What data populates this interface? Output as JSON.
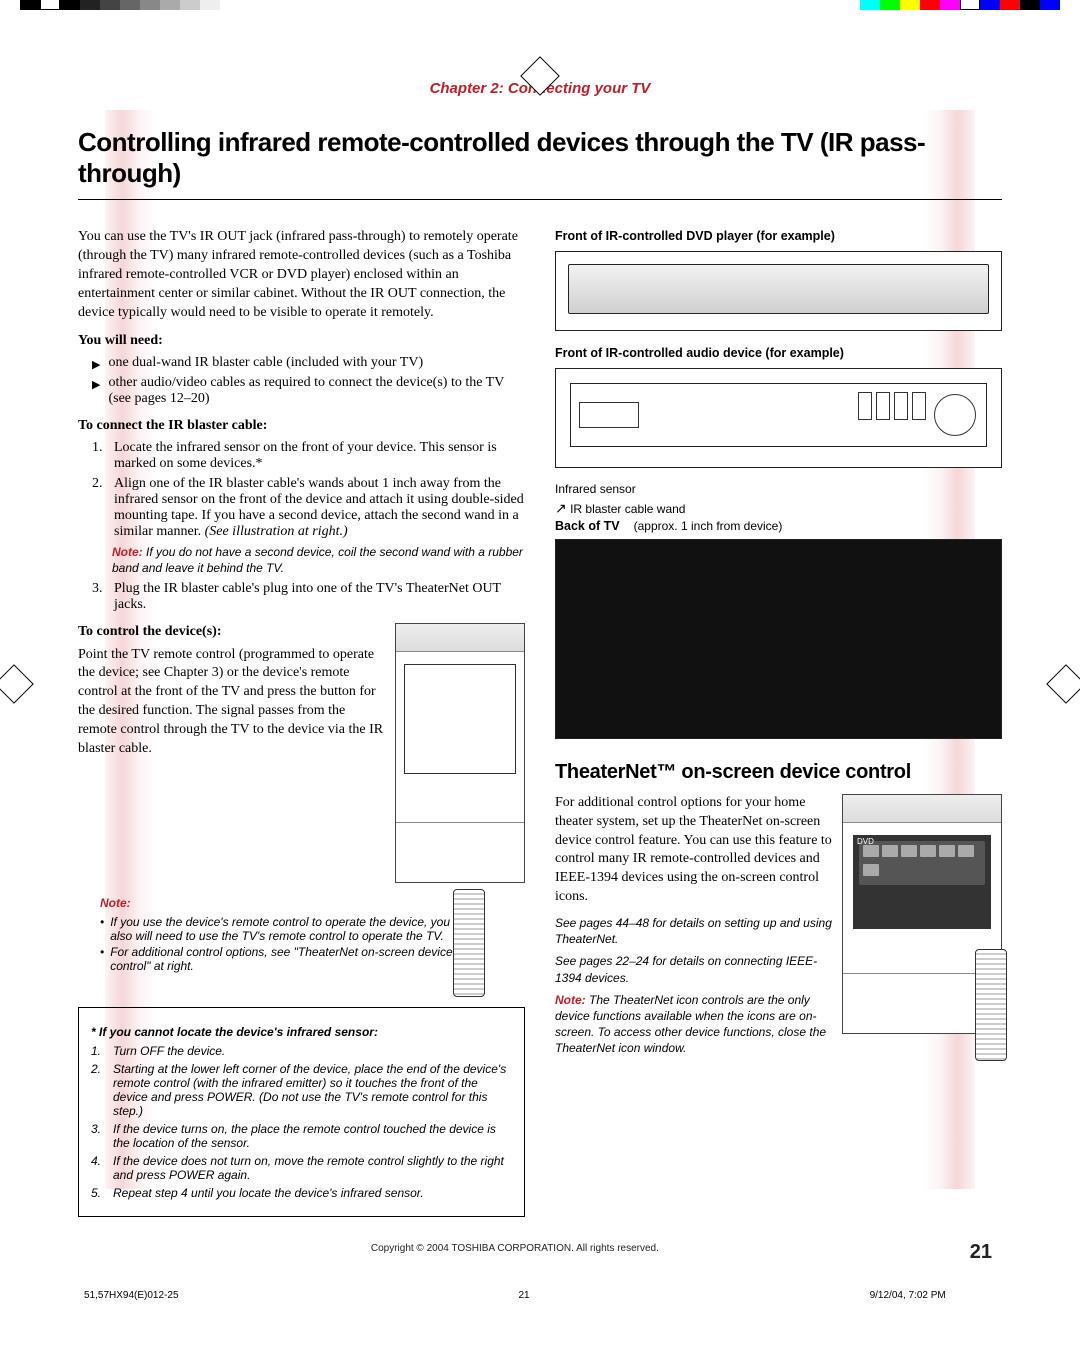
{
  "chapter": "Chapter 2: Connecting your TV",
  "title": "Controlling infrared remote-controlled devices through the TV (IR pass-through)",
  "intro": "You can use the TV's IR OUT jack (infrared pass-through) to remotely operate (through the TV) many infrared remote-controlled devices (such as a Toshiba infrared remote-controlled VCR or DVD player) enclosed within an entertainment center or similar cabinet. Without the IR OUT connection, the device typically would need to be visible to operate it remotely.",
  "need_head": "You will need:",
  "need1": "one dual-wand IR blaster cable (included with your TV)",
  "need2": "other audio/video cables as required to connect the device(s) to the TV (see pages 12–20)",
  "connect_head": "To connect the IR blaster cable:",
  "c1": "Locate the infrared sensor on the front of your device. This sensor is marked on some devices.*",
  "c2": "Align one of the IR blaster cable's wands about 1 inch away from the infrared sensor on the front of the device and attach it using double-sided mounting tape. If you have a second device, attach the second wand in a similar manner.",
  "c2_illus": "(See illustration at right.)",
  "c2_note_label": "Note:",
  "c2_note": "If you do not have a second device, coil the second wand with a rubber band and leave it behind the TV.",
  "c3": "Plug the IR blaster cable's plug into one of the TV's TheaterNet OUT jacks.",
  "control_head": "To control the device(s):",
  "control_body": "Point the TV remote control (programmed to operate the device; see Chapter 3) or the device's remote control at the front of the TV and press the button for the desired function. The signal passes from the remote control through the TV to the device via the IR blaster cable.",
  "note_label": "Note:",
  "note_b1": "If you use the device's remote control to operate the device, you also will need to use the TV's remote control to operate the TV.",
  "note_b2": "For additional control options, see \"TheaterNet on-screen device control\" at right.",
  "sensor_head": "* If you cannot locate the device's infrared sensor:",
  "s1": "Turn OFF the device.",
  "s2": "Starting at the lower left corner of the device, place the end of the device's remote control (with the infrared emitter) so it touches the front of the device and press POWER. (Do not use the TV's remote control for this step.)",
  "s3": "If the device turns on, the place the remote control touched the device is the location of the sensor.",
  "s4": "If the device does not turn on, move the remote control slightly to the right and press POWER again.",
  "s5": "Repeat step 4 until you locate the device's infrared sensor.",
  "label_dvd": "Front of IR-controlled DVD player (for example)",
  "label_audio": "Front of IR-controlled audio device (for example)",
  "label_infra": "Infrared sensor",
  "label_wand": "IR blaster cable wand",
  "label_approx": "(approx. 1 inch from device)",
  "label_back": "Back of TV",
  "theaternet_head": "TheaterNet™ on-screen device control",
  "tn_body": "For additional control options for your home theater system, set up the TheaterNet on-screen device control feature. You can use this feature to control many IR remote-controlled devices and IEEE-1394 devices using the on-screen control icons.",
  "tn_see1": "See pages 44–48 for details on setting up and using TheaterNet.",
  "tn_see2": "See pages 22–24 for details on connecting IEEE-1394 devices.",
  "tn_note_label": "Note:",
  "tn_note": "The TheaterNet icon controls are the only device functions available when the icons are on-screen. To access other device functions, close the TheaterNet icon window.",
  "copyright": "Copyright © 2004 TOSHIBA CORPORATION. All rights reserved.",
  "page_num": "21",
  "footer_file": "51,57HX94(E)012-25",
  "footer_pg": "21",
  "footer_time": "9/12/04, 7:02 PM",
  "icon_dvd_label": "DVD"
}
